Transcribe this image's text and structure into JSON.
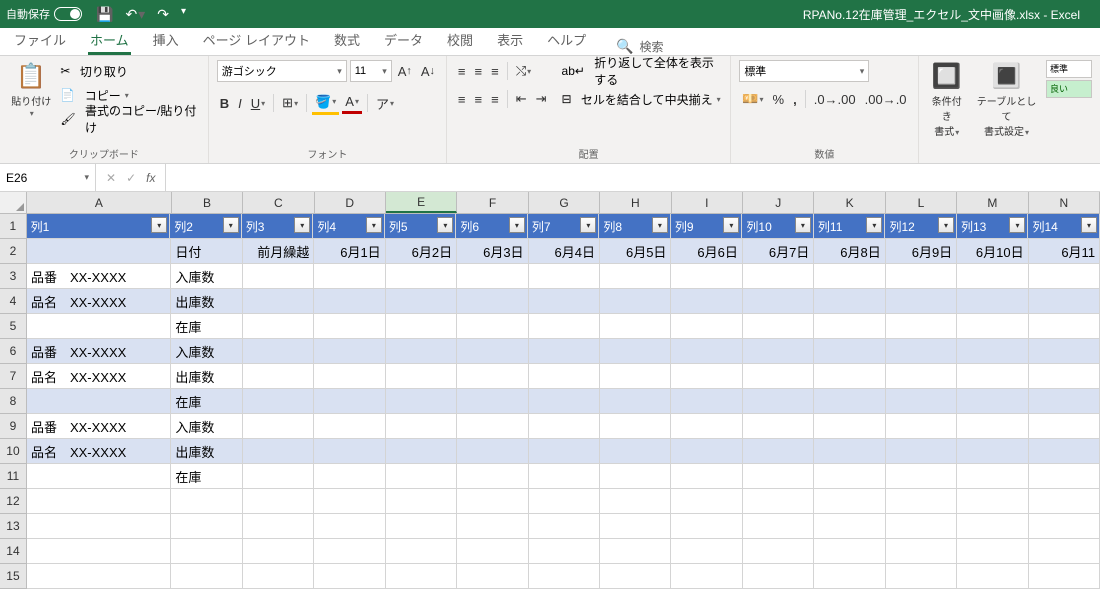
{
  "title_bar": {
    "autosave_label": "自動保存",
    "autosave_state": "オフ",
    "filename": "RPANo.12在庫管理_エクセル_文中画像.xlsx  -  Excel"
  },
  "tabs": {
    "file": "ファイル",
    "home": "ホーム",
    "insert": "挿入",
    "page_layout": "ページ レイアウト",
    "formulas": "数式",
    "data": "データ",
    "review": "校閲",
    "view": "表示",
    "help": "ヘルプ",
    "search": "検索"
  },
  "ribbon": {
    "clipboard": {
      "paste": "貼り付け",
      "cut": "切り取り",
      "copy": "コピー",
      "format_painter": "書式のコピー/貼り付け",
      "label": "クリップボード"
    },
    "font": {
      "name": "游ゴシック",
      "size": "11",
      "label": "フォント"
    },
    "alignment": {
      "wrap": "折り返して全体を表示する",
      "merge": "セルを結合して中央揃え",
      "label": "配置"
    },
    "number": {
      "format": "標準",
      "label": "数値"
    },
    "styles": {
      "cond_format": "条件付き\n書式",
      "table_format": "テーブルとして\n書式設定",
      "normal": "標準",
      "good": "良い"
    }
  },
  "namebox": "E26",
  "columns": [
    "A",
    "B",
    "C",
    "D",
    "E",
    "F",
    "G",
    "H",
    "I",
    "J",
    "K",
    "L",
    "M",
    "N"
  ],
  "row_numbers": [
    "1",
    "2",
    "3",
    "4",
    "5",
    "6",
    "7",
    "8",
    "9",
    "10",
    "11",
    "12",
    "13",
    "14",
    "15"
  ],
  "table_headers": [
    "列1",
    "列2",
    "列3",
    "列4",
    "列5",
    "列6",
    "列7",
    "列8",
    "列9",
    "列10",
    "列11",
    "列12",
    "列13",
    "列14"
  ],
  "row2": [
    "",
    "日付",
    "前月繰越",
    "6月1日",
    "6月2日",
    "6月3日",
    "6月4日",
    "6月5日",
    "6月6日",
    "6月7日",
    "6月8日",
    "6月9日",
    "6月10日",
    "6月11"
  ],
  "rows": [
    {
      "a": "品番　XX-XXXX",
      "b": "入庫数"
    },
    {
      "a": "品名　XX-XXXX",
      "b": "出庫数"
    },
    {
      "a": "",
      "b": "在庫"
    },
    {
      "a": "品番　XX-XXXX",
      "b": "入庫数"
    },
    {
      "a": "品名　XX-XXXX",
      "b": "出庫数"
    },
    {
      "a": "",
      "b": "在庫"
    },
    {
      "a": "品番　XX-XXXX",
      "b": "入庫数"
    },
    {
      "a": "品名　XX-XXXX",
      "b": "出庫数"
    },
    {
      "a": "",
      "b": "在庫"
    }
  ]
}
